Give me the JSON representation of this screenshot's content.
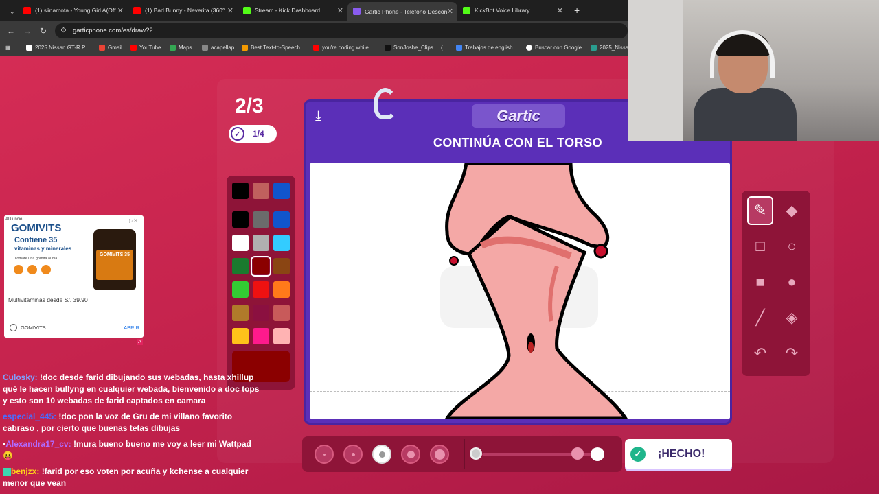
{
  "browser": {
    "tabs": [
      {
        "label": "(1) siinamota - Young Girl A(Off",
        "color": "#ff0000",
        "active": false
      },
      {
        "label": "(1) Bad Bunny - Neverita (360°",
        "color": "#ff0000",
        "active": false
      },
      {
        "label": "Stream - Kick Dashboard",
        "color": "#53fc18",
        "active": false
      },
      {
        "label": "Gartic Phone - Teléfono Descon",
        "color": "#8a5cf0",
        "active": true
      },
      {
        "label": "KickBot Voice Library",
        "color": "#53fc18",
        "active": false
      }
    ],
    "url": "garticphone.com/es/draw?2",
    "bookmarks": [
      "2025 Nissan GT-R P...",
      "Gmail",
      "YouTube",
      "Maps",
      "acapellap",
      "Best Text-to-Speech...",
      "you're coding while...",
      "SonJoshe_Clips",
      "(...",
      "Trabajos de english...",
      "Buscar con Google",
      "2025_Nissa"
    ]
  },
  "game": {
    "round": "2/3",
    "done_count": "1/4",
    "logo": "Gartic",
    "prompt": "CONTINÚA CON EL TORSO",
    "done_button": "¡HECHO!",
    "selected_color": "#8b0000",
    "palette": [
      "#000000",
      "#c0605e",
      "#1155cc",
      "#000000",
      "#6b6b6b",
      "#1155cc",
      "#ffffff",
      "#b0b0b0",
      "#33ccff",
      "#1a7a2e",
      "#8b0000",
      "#8a4513",
      "#33cc33",
      "#ee1111",
      "#ff7a1a",
      "#b07a2a",
      "#8b1040",
      "#c85a5a",
      "#ffc21a",
      "#ff1a8c",
      "#ffb3b3"
    ]
  },
  "ad": {
    "badge": "AD uncio",
    "brand": "GOMIVITS",
    "headline": "Contiene 35",
    "subhead": "vitaminas y minerales",
    "tagline": "Tómate una gomita al día",
    "price_line": "Multivitaminas desde S/. 39.90",
    "advertiser": "GOMIVITS",
    "cta": "ABRIR",
    "jar_label": "GOMIVITS 35"
  },
  "chat": [
    {
      "user": "Culosky:",
      "color": "#7fa0ff",
      "text": "!doc desde farid dibujando sus webadas, hasta xhillup qué le hacen bullyng en cualquier webada, bienvenido a doc tops y esto son 10 webadas de farid captados en camara"
    },
    {
      "user": "especial_445:",
      "color": "#4a6cff",
      "text": "!doc pon la voz de Gru de mi villano favorito cabraso , por cierto que buenas tetas dibujas"
    },
    {
      "user": "Alexandra17_cv:",
      "color": "#b06bff",
      "text": "!mura bueno bueno me voy a leer mi Wattpad 😛"
    },
    {
      "user": "benjzx:",
      "color": "#ffd21a",
      "text": "!farid por eso voten por acuña y kchense a cualquier menor que vean"
    }
  ]
}
